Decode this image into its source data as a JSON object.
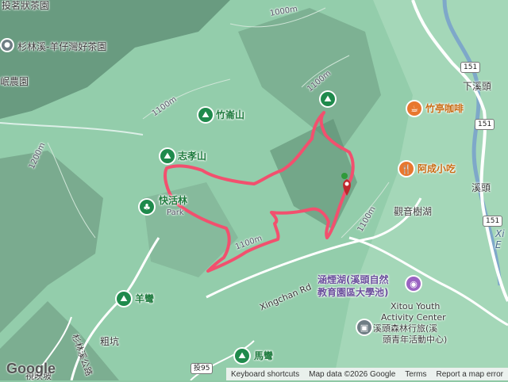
{
  "map": {
    "labels_top": [
      {
        "text": "投茗狀茶園",
        "class": "pl"
      },
      {
        "text": "杉林溪-羊仔灣好茶園",
        "class": "pl"
      },
      {
        "text": "岷農園",
        "class": "pl"
      }
    ],
    "peaks": [
      {
        "name": "竹崙山"
      },
      {
        "name": "志孝山"
      },
      {
        "name": "快活林"
      },
      {
        "name": "羊彎"
      },
      {
        "name": "馬彎"
      }
    ],
    "park_sublabel": "Park",
    "food": [
      {
        "name": "竹亭咖啡"
      },
      {
        "name": "阿成小吃"
      }
    ],
    "places": [
      {
        "text": "下溪頭"
      },
      {
        "text": "溪頭"
      },
      {
        "text": "觀音樹湖"
      },
      {
        "text": "粗坑"
      },
      {
        "text": "杉林溪公路"
      },
      {
        "text": "視映坡"
      }
    ],
    "lake_label": [
      "涵煙湖(溪頭自然",
      "教育園區大學池)"
    ],
    "youth_center": [
      "Xitou Youth",
      "Activity Center",
      "溪頭森林行旅(溪",
      "頭青年活動中心)"
    ],
    "road_name": "Xingchan Rd",
    "contours": [
      "1000m",
      "1100m",
      "1200m",
      "1100m",
      "1100m",
      "1100m"
    ],
    "shields": [
      "151",
      "151",
      "151",
      "投95"
    ],
    "edge_text": [
      "Xi",
      "E"
    ]
  },
  "footer": {
    "keyboard": "Keyboard shortcuts",
    "mapdata": "Map data ©2026 Google",
    "terms": "Terms",
    "report": "Report a map error"
  },
  "logo": "Google",
  "colors": {
    "route": "#f2506e",
    "terrain": "#8fc9a6",
    "poi": "#1f8a4c",
    "food": "#e8772e"
  }
}
